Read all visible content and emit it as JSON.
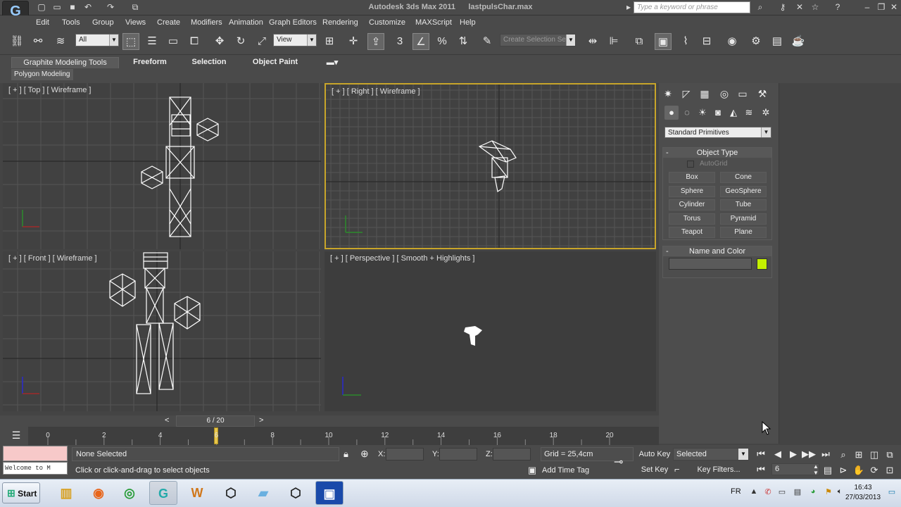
{
  "titlebar": {
    "app_title": "Autodesk 3ds Max  2011",
    "file_name": "lastpulsChar.max",
    "search_placeholder": "Type a keyword or phrase"
  },
  "menu": [
    "Edit",
    "Tools",
    "Group",
    "Views",
    "Create",
    "Modifiers",
    "Animation",
    "Graph Editors",
    "Rendering",
    "Customize",
    "MAXScript",
    "Help"
  ],
  "toolbar": {
    "filter_value": "All",
    "refcoord_value": "View",
    "snap_value": "3",
    "named_sel_placeholder": "Create Selection Se"
  },
  "ribbon": {
    "tabs": [
      "Graphite Modeling Tools",
      "Freeform",
      "Selection",
      "Object Paint"
    ],
    "sub_label": "Polygon Modeling"
  },
  "viewports": {
    "top": "[ + ] [ Top ] [ Wireframe ]",
    "right": "[ + ] [ Right ] [ Wireframe ]",
    "front": "[ + ] [ Front ] [ Wireframe ]",
    "perspective": "[ + ] [ Perspective ] [ Smooth + Highlights ]"
  },
  "command_panel": {
    "category_value": "Standard Primitives",
    "object_type_title": "Object Type",
    "autogrid_label": "AutoGrid",
    "primitives": [
      "Box",
      "Cone",
      "Sphere",
      "GeoSphere",
      "Cylinder",
      "Tube",
      "Torus",
      "Pyramid",
      "Teapot",
      "Plane"
    ],
    "name_color_title": "Name and Color",
    "object_color": "#c4f000"
  },
  "timeline": {
    "frame_display": "6 / 20",
    "ticks": [
      "0",
      "2",
      "4",
      "6",
      "8",
      "10",
      "12",
      "14",
      "16",
      "18",
      "20"
    ],
    "current_frame": 6,
    "total_frames": 20
  },
  "status": {
    "listener_text": "Welcome to M",
    "selection_info": "None Selected",
    "prompt": "Click or click-and-drag to select objects",
    "x_label": "X:",
    "y_label": "Y:",
    "z_label": "Z:",
    "grid_info": "Grid = 25,4cm",
    "add_time_tag": "Add Time Tag",
    "auto_key": "Auto Key",
    "set_key": "Set Key",
    "selected_value": "Selected",
    "key_filters": "Key Filters...",
    "frame_value": "6"
  },
  "taskbar": {
    "start_label": "Start",
    "language": "FR",
    "time": "16:43",
    "date": "27/03/2013"
  },
  "colors": {
    "active_viewport_border": "#c8a52a",
    "viewport_bg": "#414141",
    "ui_bg": "#4a4a4a"
  }
}
